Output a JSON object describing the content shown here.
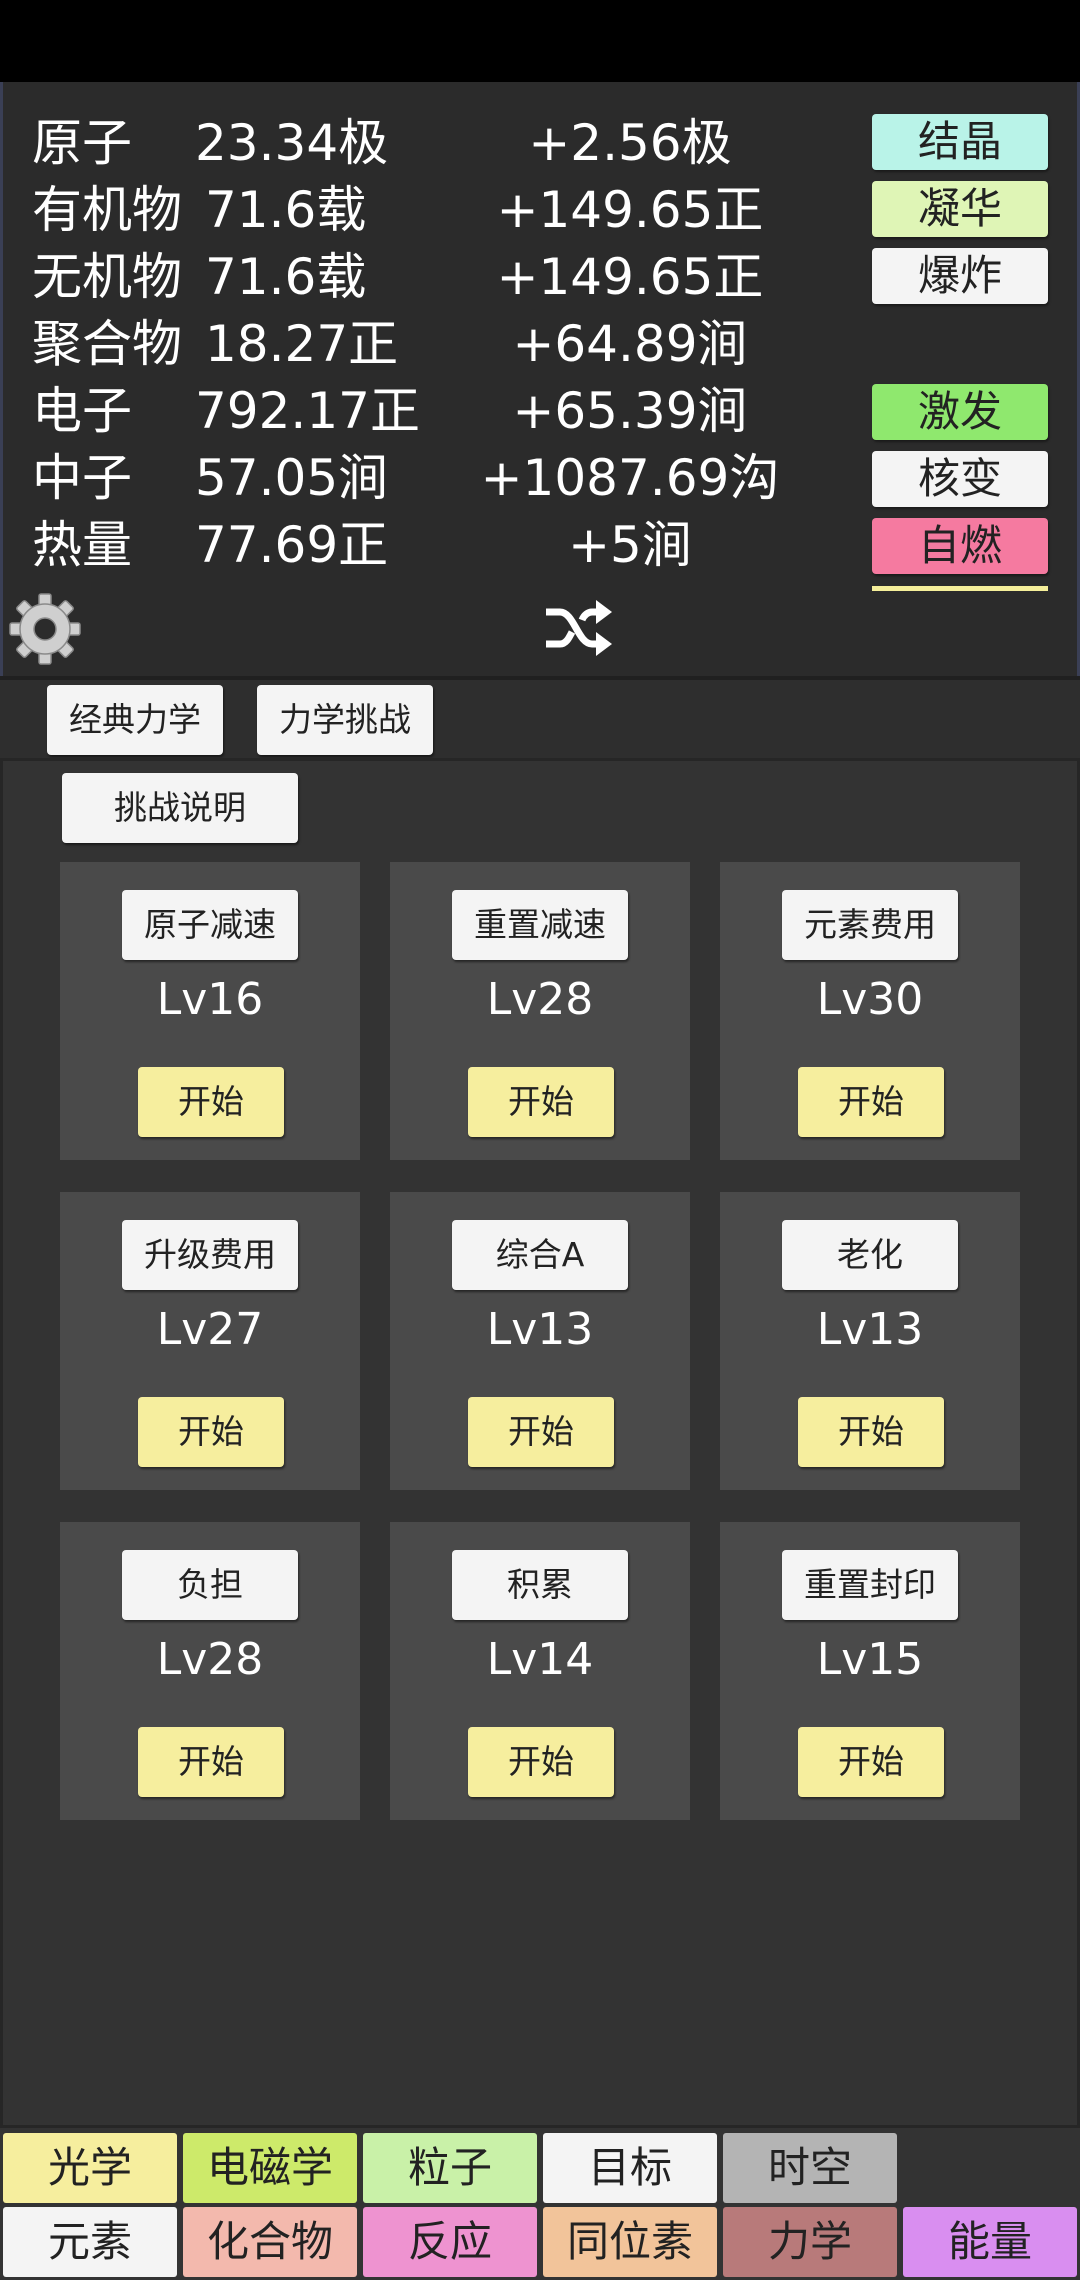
{
  "resources": [
    {
      "name": "原子",
      "amount": "23.34极",
      "rate": "+2.56极"
    },
    {
      "name": "有机物",
      "amount": "71.6载",
      "rate": "+149.65正"
    },
    {
      "name": "无机物",
      "amount": "71.6载",
      "rate": "+149.65正"
    },
    {
      "name": "聚合物",
      "amount": "18.27正",
      "rate": "+64.89涧"
    },
    {
      "name": "电子",
      "amount": "792.17正",
      "rate": "+65.39涧"
    },
    {
      "name": "中子",
      "amount": "57.05涧",
      "rate": "+1087.69沟"
    },
    {
      "name": "热量",
      "amount": "77.69正",
      "rate": "+5涧"
    }
  ],
  "actions": [
    {
      "label": "结晶",
      "color": "#b9f3e8"
    },
    {
      "label": "凝华",
      "color": "#dff5b6"
    },
    {
      "label": "爆炸",
      "color": "#f4f4f4"
    },
    {
      "label": "激发",
      "color": "#8fe86e"
    },
    {
      "label": "核变",
      "color": "#f4f4f4"
    },
    {
      "label": "自燃",
      "color": "#f57aa0"
    }
  ],
  "icons": {
    "settings": "gear-icon",
    "shuffle": "shuffle-icon"
  },
  "subtabs": [
    "经典力学",
    "力学挑战"
  ],
  "explain_label": "挑战说明",
  "challenges": [
    {
      "name": "原子减速",
      "level": "Lv16",
      "start": "开始"
    },
    {
      "name": "重置减速",
      "level": "Lv28",
      "start": "开始"
    },
    {
      "name": "元素费用",
      "level": "Lv30",
      "start": "开始"
    },
    {
      "name": "升级费用",
      "level": "Lv27",
      "start": "开始"
    },
    {
      "name": "综合A",
      "level": "Lv13",
      "start": "开始"
    },
    {
      "name": "老化",
      "level": "Lv13",
      "start": "开始"
    },
    {
      "name": "负担",
      "level": "Lv28",
      "start": "开始"
    },
    {
      "name": "积累",
      "level": "Lv14",
      "start": "开始"
    },
    {
      "name": "重置封印",
      "level": "Lv15",
      "start": "开始"
    }
  ],
  "nav_top": [
    {
      "label": "光学",
      "color": "#f6ee9e"
    },
    {
      "label": "电磁学",
      "color": "#cdea6a"
    },
    {
      "label": "粒子",
      "color": "#c9f1a8"
    },
    {
      "label": "目标",
      "color": "#f4f4f4"
    },
    {
      "label": "时空",
      "color": "#b4b4b4"
    }
  ],
  "nav_bottom": [
    {
      "label": "元素",
      "color": "#f4f4f4"
    },
    {
      "label": "化合物",
      "color": "#f3b9ad"
    },
    {
      "label": "反应",
      "color": "#ee93d0"
    },
    {
      "label": "同位素",
      "color": "#f2c49a"
    },
    {
      "label": "力学",
      "color": "#b87a7a"
    },
    {
      "label": "能量",
      "color": "#d98ef0"
    }
  ]
}
